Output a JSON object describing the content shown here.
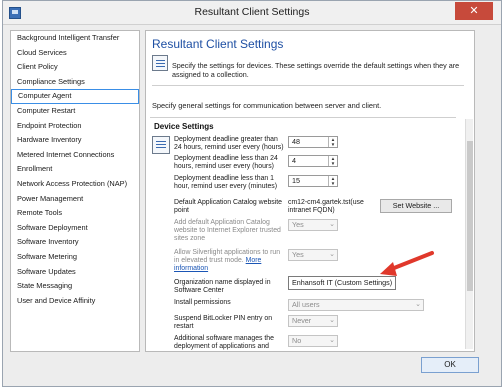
{
  "window": {
    "title": "Resultant Client Settings",
    "close_glyph": "✕"
  },
  "sidebar": {
    "items": [
      {
        "label": "Background Intelligent Transfer"
      },
      {
        "label": "Cloud Services"
      },
      {
        "label": "Client Policy"
      },
      {
        "label": "Compliance Settings"
      },
      {
        "label": "Computer Agent",
        "selected": true
      },
      {
        "label": "Computer Restart"
      },
      {
        "label": "Endpoint Protection"
      },
      {
        "label": "Hardware Inventory"
      },
      {
        "label": "Metered Internet Connections"
      },
      {
        "label": "Enrollment"
      },
      {
        "label": "Network Access Protection (NAP)"
      },
      {
        "label": "Power Management"
      },
      {
        "label": "Remote Tools"
      },
      {
        "label": "Software Deployment"
      },
      {
        "label": "Software Inventory"
      },
      {
        "label": "Software Metering"
      },
      {
        "label": "Software Updates"
      },
      {
        "label": "State Messaging"
      },
      {
        "label": "User and Device Affinity"
      }
    ]
  },
  "main": {
    "title": "Resultant Client Settings",
    "description": "Specify the settings for devices. These settings override the default settings when they are assigned to a collection.",
    "general_text": "Specify general settings for communication between server and client.",
    "device_heading": "Device Settings",
    "settings": {
      "deadline_greater_24": {
        "label": "Deployment deadline greater than 24 hours, remind user every (hours)",
        "value": "48"
      },
      "deadline_less_24": {
        "label": "Deployment deadline less than 24 hours, remind user every (hours)",
        "value": "4"
      },
      "deadline_less_1": {
        "label": "Deployment deadline less than 1 hour, remind user every (minutes)",
        "value": "15"
      },
      "default_catalog": {
        "label": "Default Application Catalog website point",
        "value": "cm12-cm4.gartek.tst(use intranet FQDN)",
        "button": "Set Website ..."
      },
      "add_catalog": {
        "label": "Add default Application Catalog website to Internet Explorer trusted sites zone",
        "value": "Yes"
      },
      "silverlight": {
        "label": "Allow Silverlight applications to run in elevated trust mode.",
        "link": "More information",
        "value": "Yes"
      },
      "org_name": {
        "label": "Organization name displayed in Software Center",
        "value": "Enhansoft IT (Custom Settings)"
      },
      "install_permissions": {
        "label": "Install permissions",
        "value": "All users"
      },
      "bitlocker": {
        "label": "Suspend BitLocker PIN entry on restart",
        "value": "Never"
      },
      "additional_software": {
        "label": "Additional software manages the deployment of applications and software updates",
        "value": "No"
      }
    }
  },
  "footer": {
    "ok_label": "OK"
  },
  "colors": {
    "title_blue": "#1e4fa3",
    "selection_border": "#3a8ee6",
    "annotation_arrow": "#e0382b",
    "close_red": "#c74a3b"
  }
}
